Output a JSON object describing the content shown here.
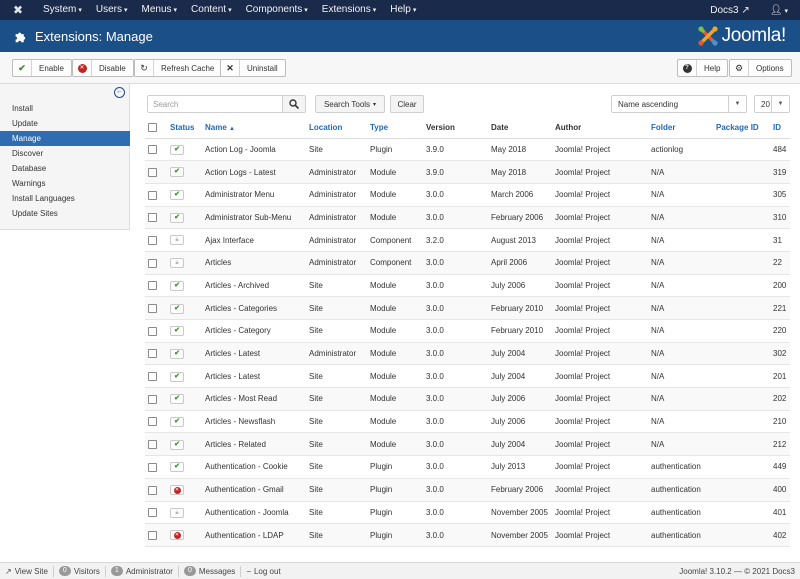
{
  "nav": {
    "menu": [
      {
        "label": "System"
      },
      {
        "label": "Users"
      },
      {
        "label": "Menus"
      },
      {
        "label": "Content"
      },
      {
        "label": "Components"
      },
      {
        "label": "Extensions"
      },
      {
        "label": "Help"
      }
    ],
    "site_link": "Docs3",
    "user_icon": "user-icon"
  },
  "header": {
    "title": "Extensions: Manage",
    "brand": "Joomla!"
  },
  "toolbar": {
    "enable": "Enable",
    "disable": "Disable",
    "refresh": "Refresh Cache",
    "uninstall": "Uninstall",
    "help": "Help",
    "options": "Options"
  },
  "sidebar": {
    "items": [
      {
        "label": "Install"
      },
      {
        "label": "Update"
      },
      {
        "label": "Manage"
      },
      {
        "label": "Discover"
      },
      {
        "label": "Database"
      },
      {
        "label": "Warnings"
      },
      {
        "label": "Install Languages"
      },
      {
        "label": "Update Sites"
      }
    ],
    "active_index": 2
  },
  "filters": {
    "search_placeholder": "Search",
    "search_tools": "Search Tools",
    "clear": "Clear",
    "ordering": "Name ascending",
    "limit": "20"
  },
  "table": {
    "headers": {
      "status": "Status",
      "name": "Name",
      "location": "Location",
      "type": "Type",
      "version": "Version",
      "date": "Date",
      "author": "Author",
      "folder": "Folder",
      "package_id": "Package ID",
      "id": "ID"
    },
    "rows": [
      {
        "status": "enabled",
        "name": "Action Log - Joomla",
        "location": "Site",
        "type": "Plugin",
        "version": "3.9.0",
        "date": "May 2018",
        "author": "Joomla! Project",
        "folder": "actionlog",
        "package_id": "",
        "id": "484"
      },
      {
        "status": "enabled",
        "name": "Action Logs - Latest",
        "location": "Administrator",
        "type": "Module",
        "version": "3.9.0",
        "date": "May 2018",
        "author": "Joomla! Project",
        "folder": "N/A",
        "package_id": "",
        "id": "319"
      },
      {
        "status": "enabled",
        "name": "Administrator Menu",
        "location": "Administrator",
        "type": "Module",
        "version": "3.0.0",
        "date": "March 2006",
        "author": "Joomla! Project",
        "folder": "N/A",
        "package_id": "",
        "id": "305"
      },
      {
        "status": "enabled",
        "name": "Administrator Sub-Menu",
        "location": "Administrator",
        "type": "Module",
        "version": "3.0.0",
        "date": "February 2006",
        "author": "Joomla! Project",
        "folder": "N/A",
        "package_id": "",
        "id": "310"
      },
      {
        "status": "locked",
        "name": "Ajax Interface",
        "location": "Administrator",
        "type": "Component",
        "version": "3.2.0",
        "date": "August 2013",
        "author": "Joomla! Project",
        "folder": "N/A",
        "package_id": "",
        "id": "31"
      },
      {
        "status": "locked",
        "name": "Articles",
        "location": "Administrator",
        "type": "Component",
        "version": "3.0.0",
        "date": "April 2006",
        "author": "Joomla! Project",
        "folder": "N/A",
        "package_id": "",
        "id": "22"
      },
      {
        "status": "enabled",
        "name": "Articles - Archived",
        "location": "Site",
        "type": "Module",
        "version": "3.0.0",
        "date": "July 2006",
        "author": "Joomla! Project",
        "folder": "N/A",
        "package_id": "",
        "id": "200"
      },
      {
        "status": "enabled",
        "name": "Articles - Categories",
        "location": "Site",
        "type": "Module",
        "version": "3.0.0",
        "date": "February 2010",
        "author": "Joomla! Project",
        "folder": "N/A",
        "package_id": "",
        "id": "221"
      },
      {
        "status": "enabled",
        "name": "Articles - Category",
        "location": "Site",
        "type": "Module",
        "version": "3.0.0",
        "date": "February 2010",
        "author": "Joomla! Project",
        "folder": "N/A",
        "package_id": "",
        "id": "220"
      },
      {
        "status": "enabled",
        "name": "Articles - Latest",
        "location": "Administrator",
        "type": "Module",
        "version": "3.0.0",
        "date": "July 2004",
        "author": "Joomla! Project",
        "folder": "N/A",
        "package_id": "",
        "id": "302"
      },
      {
        "status": "enabled",
        "name": "Articles - Latest",
        "location": "Site",
        "type": "Module",
        "version": "3.0.0",
        "date": "July 2004",
        "author": "Joomla! Project",
        "folder": "N/A",
        "package_id": "",
        "id": "201"
      },
      {
        "status": "enabled",
        "name": "Articles - Most Read",
        "location": "Site",
        "type": "Module",
        "version": "3.0.0",
        "date": "July 2006",
        "author": "Joomla! Project",
        "folder": "N/A",
        "package_id": "",
        "id": "202"
      },
      {
        "status": "enabled",
        "name": "Articles - Newsflash",
        "location": "Site",
        "type": "Module",
        "version": "3.0.0",
        "date": "July 2006",
        "author": "Joomla! Project",
        "folder": "N/A",
        "package_id": "",
        "id": "210"
      },
      {
        "status": "enabled",
        "name": "Articles - Related",
        "location": "Site",
        "type": "Module",
        "version": "3.0.0",
        "date": "July 2004",
        "author": "Joomla! Project",
        "folder": "N/A",
        "package_id": "",
        "id": "212"
      },
      {
        "status": "enabled",
        "name": "Authentication - Cookie",
        "location": "Site",
        "type": "Plugin",
        "version": "3.0.0",
        "date": "July 2013",
        "author": "Joomla! Project",
        "folder": "authentication",
        "package_id": "",
        "id": "449"
      },
      {
        "status": "disabled",
        "name": "Authentication - Gmail",
        "location": "Site",
        "type": "Plugin",
        "version": "3.0.0",
        "date": "February 2006",
        "author": "Joomla! Project",
        "folder": "authentication",
        "package_id": "",
        "id": "400"
      },
      {
        "status": "locked",
        "name": "Authentication - Joomla",
        "location": "Site",
        "type": "Plugin",
        "version": "3.0.0",
        "date": "November 2005",
        "author": "Joomla! Project",
        "folder": "authentication",
        "package_id": "",
        "id": "401"
      },
      {
        "status": "disabled",
        "name": "Authentication - LDAP",
        "location": "Site",
        "type": "Plugin",
        "version": "3.0.0",
        "date": "November 2005",
        "author": "Joomla! Project",
        "folder": "authentication",
        "package_id": "",
        "id": "402"
      }
    ]
  },
  "footer": {
    "view_site": "View Site",
    "visitors_count": "0",
    "visitors_label": "Visitors",
    "admin_count": "1",
    "admin_label": "Administrator",
    "messages_count": "0",
    "messages_label": "Messages",
    "logout": "Log out",
    "version": "Joomla! 3.10.2 — © 2021 Docs3"
  },
  "colors": {
    "navbar": "#1a2a4a",
    "header": "#1b4f88",
    "active": "#2f6db0",
    "link": "#2569b5",
    "enabled": "#3e8e2f",
    "disabled": "#c12424"
  }
}
